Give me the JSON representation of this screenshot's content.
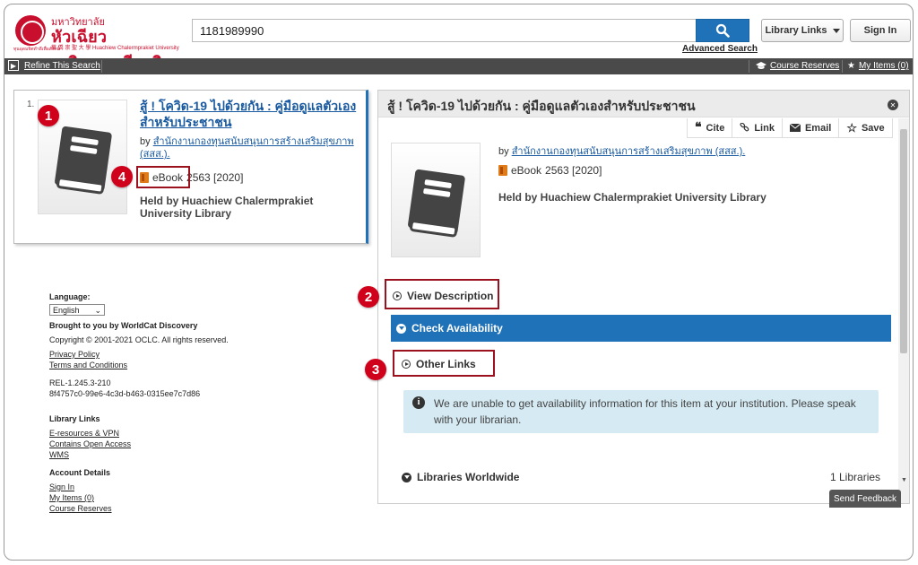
{
  "header": {
    "logo_thai_small": "มหาวิทยาลัย",
    "logo_thai_big": "หัวเฉียวเฉลิมพระเกียรติ",
    "logo_sub": "華 僑 崇 聖 大 學   Huachiew Chalermprakiet University",
    "logo_caption": "ทุนอุดมจิตทำดีเพื่อสังคม",
    "search_value": "1181989990",
    "advanced_search": "Advanced Search",
    "library_links": "Library Links",
    "sign_in": "Sign In"
  },
  "toolbar": {
    "refine": "Refine This Search",
    "course_reserves": "Course Reserves",
    "my_items": "My Items (0)"
  },
  "result": {
    "number": "1.",
    "title": "สู้ ! โควิด-19 ไปด้วยกัน : คู่มือดูแลตัวเองสำหรับประชาชน",
    "by": "by",
    "author": "สำนักงานกองทุนสนับสนุนการสร้างเสริมสุขภาพ (สสส.).",
    "format": "eBook",
    "year": "2563 [2020]",
    "held": "Held by Huachiew Chalermprakiet University Library"
  },
  "callouts": {
    "one": "1",
    "two": "2",
    "three": "3",
    "four": "4"
  },
  "footer": {
    "language_label": "Language:",
    "language_value": "English",
    "brought": "Brought to you by WorldCat Discovery",
    "copyright": "Copyright © 2001-2021 OCLC.  All rights reserved.",
    "privacy": "Privacy Policy",
    "terms": "Terms and Conditions",
    "rel": "REL-1.245.3-210",
    "hash": "8f4757c0-99e6-4c3d-b463-0315ee7c7d86",
    "library_links_heading": "Library Links",
    "eresources": "E-resources & VPN",
    "open_access": "Contains Open Access",
    "wms": "WMS",
    "account_heading": "Account Details",
    "sign_in": "Sign In",
    "my_items": "My Items (0)",
    "course_reserves": "Course Reserves"
  },
  "detail": {
    "title": "สู้ ! โควิด-19 ไปด้วยกัน : คู่มือดูแลตัวเองสำหรับประชาชน",
    "actions": {
      "cite": "Cite",
      "link": "Link",
      "email": "Email",
      "save": "Save"
    },
    "by": "by",
    "author": "สำนักงานกองทุนสนับสนุนการสร้างเสริมสุขภาพ (สสส.).",
    "format": "eBook",
    "year": "2563 [2020]",
    "held": "Held by Huachiew Chalermprakiet University Library",
    "view_description": "View Description",
    "check_availability": "Check Availability",
    "other_links": "Other Links",
    "notice": "We are unable to get availability information for this item at your institution. Please speak with your librarian.",
    "libraries_worldwide": "Libraries Worldwide",
    "libraries_count": "1 Libraries"
  },
  "send_feedback": "Send Feedback",
  "colors": {
    "accent_blue": "#1f72b8",
    "brand_red": "#c8102e",
    "callout_red": "#d0021b"
  }
}
